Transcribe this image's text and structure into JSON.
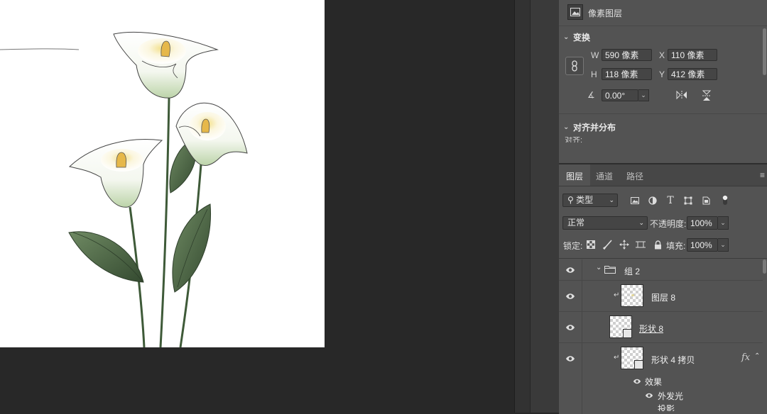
{
  "properties": {
    "pixel_layer_label": "像素图层",
    "transform_title": "变换",
    "w_label": "W",
    "w_value": "590 像素",
    "x_label": "X",
    "x_value": "110 像素",
    "h_label": "H",
    "h_value": "118 像素",
    "y_label": "Y",
    "y_value": "412 像素",
    "angle_value": "0.00°",
    "align_title": "对齐并分布",
    "align_sub": "对齐:"
  },
  "layers_panel": {
    "tabs": [
      {
        "label": "图层",
        "active": true
      },
      {
        "label": "通道",
        "active": false
      },
      {
        "label": "路径",
        "active": false
      }
    ],
    "filter_kind": "类型",
    "blend_mode": "正常",
    "opacity_label": "不透明度:",
    "opacity_value": "100%",
    "lock_label": "锁定:",
    "fill_label": "填充:",
    "fill_value": "100%",
    "layers": [
      {
        "name": "组 2",
        "type": "group",
        "expanded": true
      },
      {
        "name": "图层 8",
        "type": "pixel",
        "clipped": true
      },
      {
        "name": "形状 8",
        "type": "shape",
        "underlined": true
      },
      {
        "name": "形状 4 拷贝",
        "type": "shape",
        "clipped": true,
        "fx": "fx"
      }
    ],
    "effects_label": "效果",
    "effects": [
      "外发光",
      "投影"
    ]
  },
  "colors": {
    "workspace": "#282828",
    "panel": "#535353",
    "leaf_green": "#4f6b48",
    "flower_center": "#e6b84a"
  }
}
